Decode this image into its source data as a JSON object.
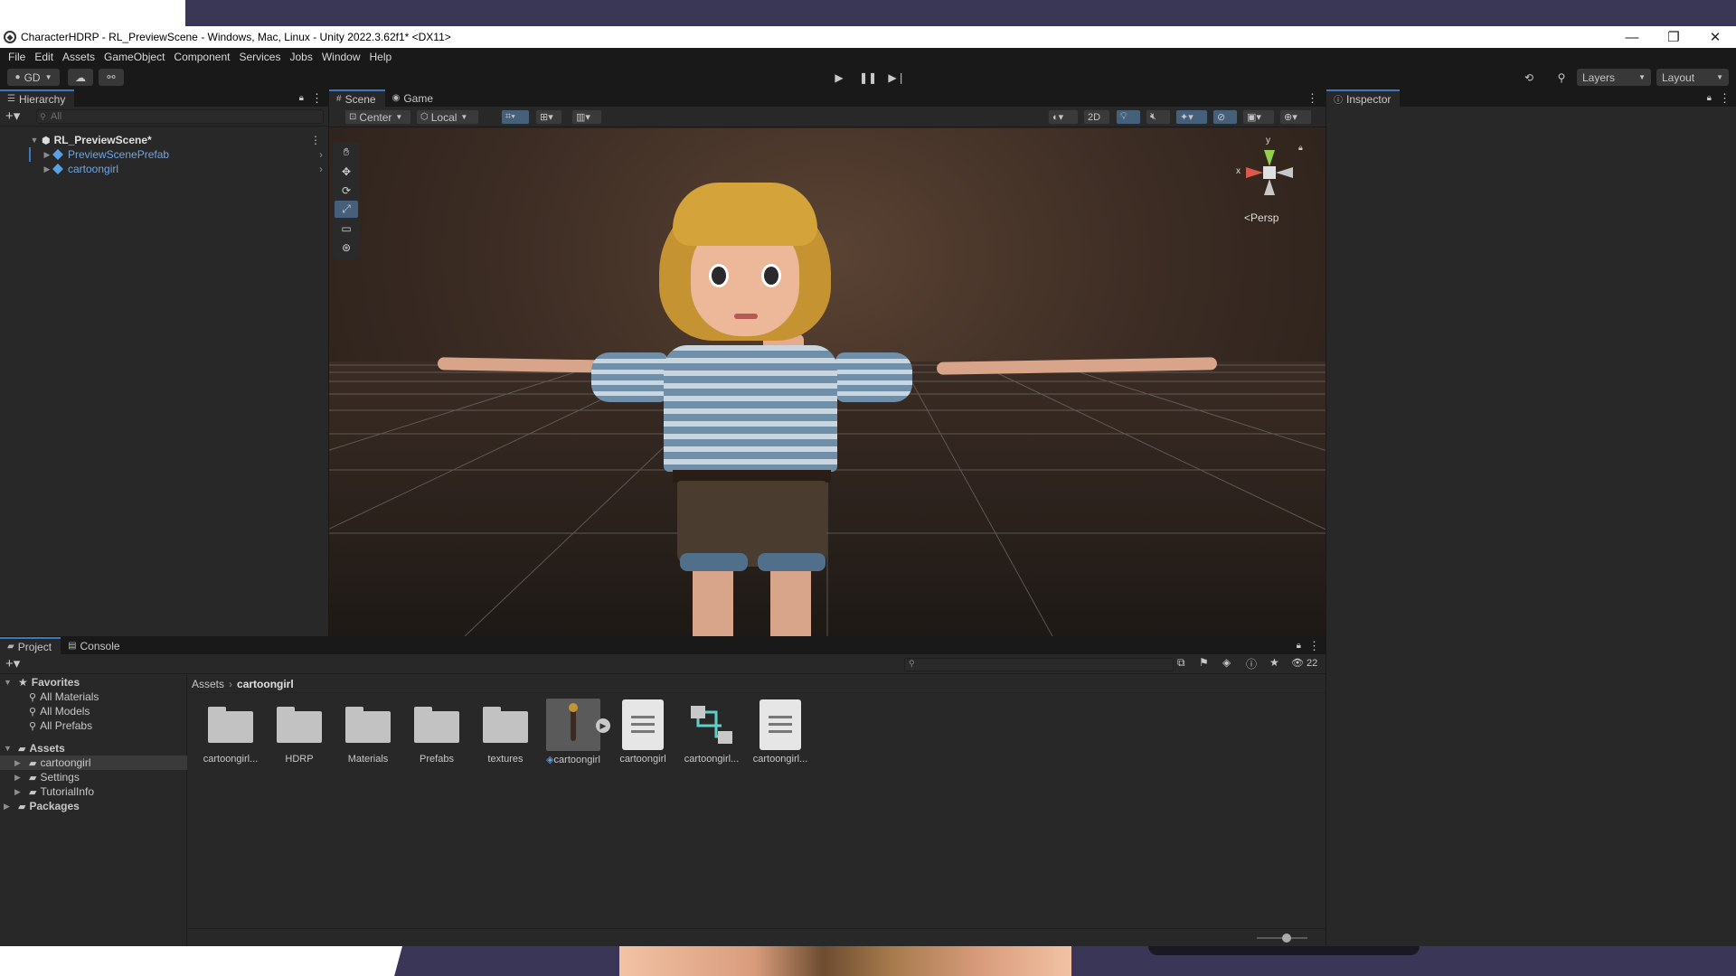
{
  "window": {
    "title": "CharacterHDRP - RL_PreviewScene - Windows, Mac, Linux - Unity 2022.3.62f1* <DX11>",
    "controls": {
      "minimize": "—",
      "restore": "❐",
      "close": "✕"
    }
  },
  "menu": [
    "File",
    "Edit",
    "Assets",
    "GameObject",
    "Component",
    "Services",
    "Jobs",
    "Window",
    "Help"
  ],
  "toolbar": {
    "account": "GD",
    "layers": "Layers",
    "layout": "Layout"
  },
  "hierarchy": {
    "tab": "Hierarchy",
    "search_placeholder": "All",
    "scene": "RL_PreviewScene*",
    "items": [
      "PreviewScenePrefab",
      "cartoongirl"
    ]
  },
  "scene_view": {
    "tabs": [
      "Scene",
      "Game"
    ],
    "pivot": "Center",
    "space": "Local",
    "mode_2d": "2D",
    "projection": "Persp",
    "gizmo_axes": {
      "y": "y",
      "x": "x"
    }
  },
  "inspector": {
    "tab": "Inspector"
  },
  "project": {
    "tabs": [
      "Project",
      "Console"
    ],
    "hidden_count": "22",
    "favorites": {
      "label": "Favorites",
      "items": [
        "All Materials",
        "All Models",
        "All Prefabs"
      ]
    },
    "assets": {
      "label": "Assets",
      "items": [
        "cartoongirl",
        "Settings",
        "TutorialInfo"
      ]
    },
    "packages": "Packages",
    "breadcrumb": [
      "Assets",
      "cartoongirl"
    ],
    "grid": [
      {
        "label": "cartoongirl...",
        "kind": "folder"
      },
      {
        "label": "HDRP",
        "kind": "folder"
      },
      {
        "label": "Materials",
        "kind": "folder"
      },
      {
        "label": "Prefabs",
        "kind": "folder"
      },
      {
        "label": "textures",
        "kind": "folder"
      },
      {
        "label": "cartoongirl",
        "kind": "model"
      },
      {
        "label": "cartoongirl",
        "kind": "doc"
      },
      {
        "label": "cartoongirl...",
        "kind": "anim"
      },
      {
        "label": "cartoongirl...",
        "kind": "doc"
      }
    ]
  },
  "colors": {
    "accent": "#3a79bb",
    "selected_text": "#6fa6e3",
    "panel": "#282828",
    "chrome": "#191919"
  }
}
